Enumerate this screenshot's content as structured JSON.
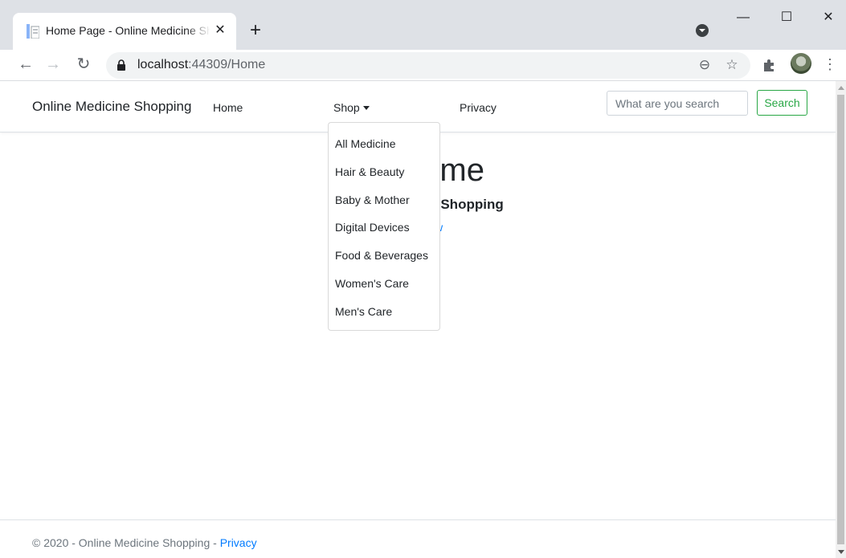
{
  "browser": {
    "tab_title": "Home Page - Online Medicine Shopping",
    "tab_close": "✕",
    "new_tab": "+",
    "url_host": "localhost",
    "url_path": ":44309/Home",
    "icons": {
      "back": "arrow-left-icon",
      "forward": "arrow-right-icon",
      "reload": "reload-icon",
      "lock": "lock-icon",
      "zoom": "zoom-icon",
      "star": "star-icon",
      "extensions": "puzzle-icon",
      "menu": "more-vert-icon"
    },
    "window_controls": {
      "minimize": "—",
      "maximize": "☐",
      "close": "✕"
    }
  },
  "navbar": {
    "brand": "Online Medicine Shopping",
    "links": {
      "home": "Home",
      "shop": "Shop",
      "privacy": "Privacy"
    },
    "search_placeholder": "What are you search",
    "search_button": "Search"
  },
  "shop_menu": {
    "items": [
      "All Medicine",
      "Hair & Beauty",
      "Baby & Mother",
      "Digital Devices",
      "Food & Beverages",
      "Women's Care",
      "Men's Care"
    ]
  },
  "main": {
    "title": "Welcome",
    "subtitle": "Online Medicine Shopping",
    "link": "Shop now"
  },
  "footer": {
    "text": "© 2020 - Online Medicine Shopping - ",
    "privacy_link": "Privacy"
  },
  "colors": {
    "accent_green": "#28a745",
    "link_blue": "#007bff"
  }
}
